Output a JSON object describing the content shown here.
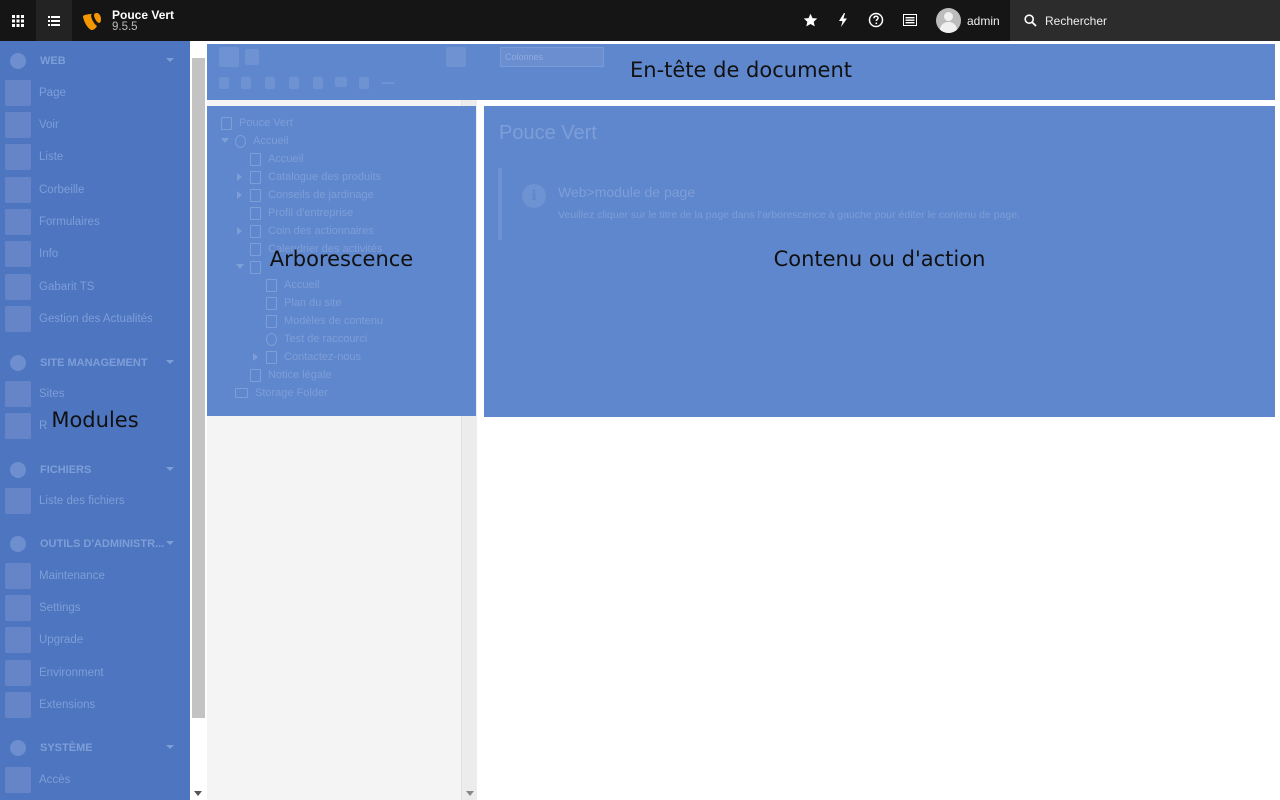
{
  "topbar": {
    "site_name": "Pouce Vert",
    "version": "9.5.5",
    "user_name": "admin",
    "search_placeholder": "Rechercher",
    "brand_color": "#f49700"
  },
  "modules": {
    "overlay_label": "Modules",
    "groups": [
      {
        "label": "WEB",
        "items": [
          "Page",
          "Voir",
          "Liste",
          "Corbeille",
          "Formulaires",
          "Info",
          "Gabarit TS",
          "Gestion des Actualités"
        ]
      },
      {
        "label": "SITE MANAGEMENT",
        "items": [
          "Sites",
          "R"
        ]
      },
      {
        "label": "FICHIERS",
        "items": [
          "Liste des fichiers"
        ]
      },
      {
        "label": "OUTILS D'ADMINISTR...",
        "items": [
          "Maintenance",
          "Settings",
          "Upgrade",
          "Environment",
          "Extensions"
        ]
      },
      {
        "label": "SYSTÈME",
        "items": [
          "Accès"
        ]
      }
    ]
  },
  "doc_header": {
    "overlay_label": "En-tête de document",
    "view_select": "Colonnes"
  },
  "tree": {
    "overlay_label": "Arborescence",
    "nodes": [
      {
        "label": "Pouce Vert",
        "depth": 0,
        "caret": ""
      },
      {
        "label": "Accueil",
        "depth": 1,
        "caret": "open"
      },
      {
        "label": "Accueil",
        "depth": 2,
        "caret": ""
      },
      {
        "label": "Catalogue des produits",
        "depth": 2,
        "caret": "closed"
      },
      {
        "label": "Conseils de jardinage",
        "depth": 2,
        "caret": "closed"
      },
      {
        "label": "Profil d'entreprise",
        "depth": 2,
        "caret": ""
      },
      {
        "label": "Coin des actionnaires",
        "depth": 2,
        "caret": "closed"
      },
      {
        "label": "Calendrier des activités",
        "depth": 2,
        "caret": ""
      },
      {
        "label": "",
        "depth": 2,
        "caret": "open"
      },
      {
        "label": "Accueil",
        "depth": 3,
        "caret": ""
      },
      {
        "label": "Plan du site",
        "depth": 3,
        "caret": ""
      },
      {
        "label": "Modèles de contenu",
        "depth": 3,
        "caret": ""
      },
      {
        "label": "Test de raccourci",
        "depth": 3,
        "caret": ""
      },
      {
        "label": "Contactez-nous",
        "depth": 3,
        "caret": "closed"
      },
      {
        "label": "Notice légale",
        "depth": 2,
        "caret": ""
      },
      {
        "label": "Storage Folder",
        "depth": 1,
        "caret": ""
      }
    ]
  },
  "content": {
    "overlay_label": "Contenu ou d'action",
    "page_title": "Pouce Vert",
    "callout_title": "Web>module de page",
    "callout_text": "Veuillez cliquer sur le titre de la page dans l'arborescence à gauche pour éditer le contenu de page."
  }
}
